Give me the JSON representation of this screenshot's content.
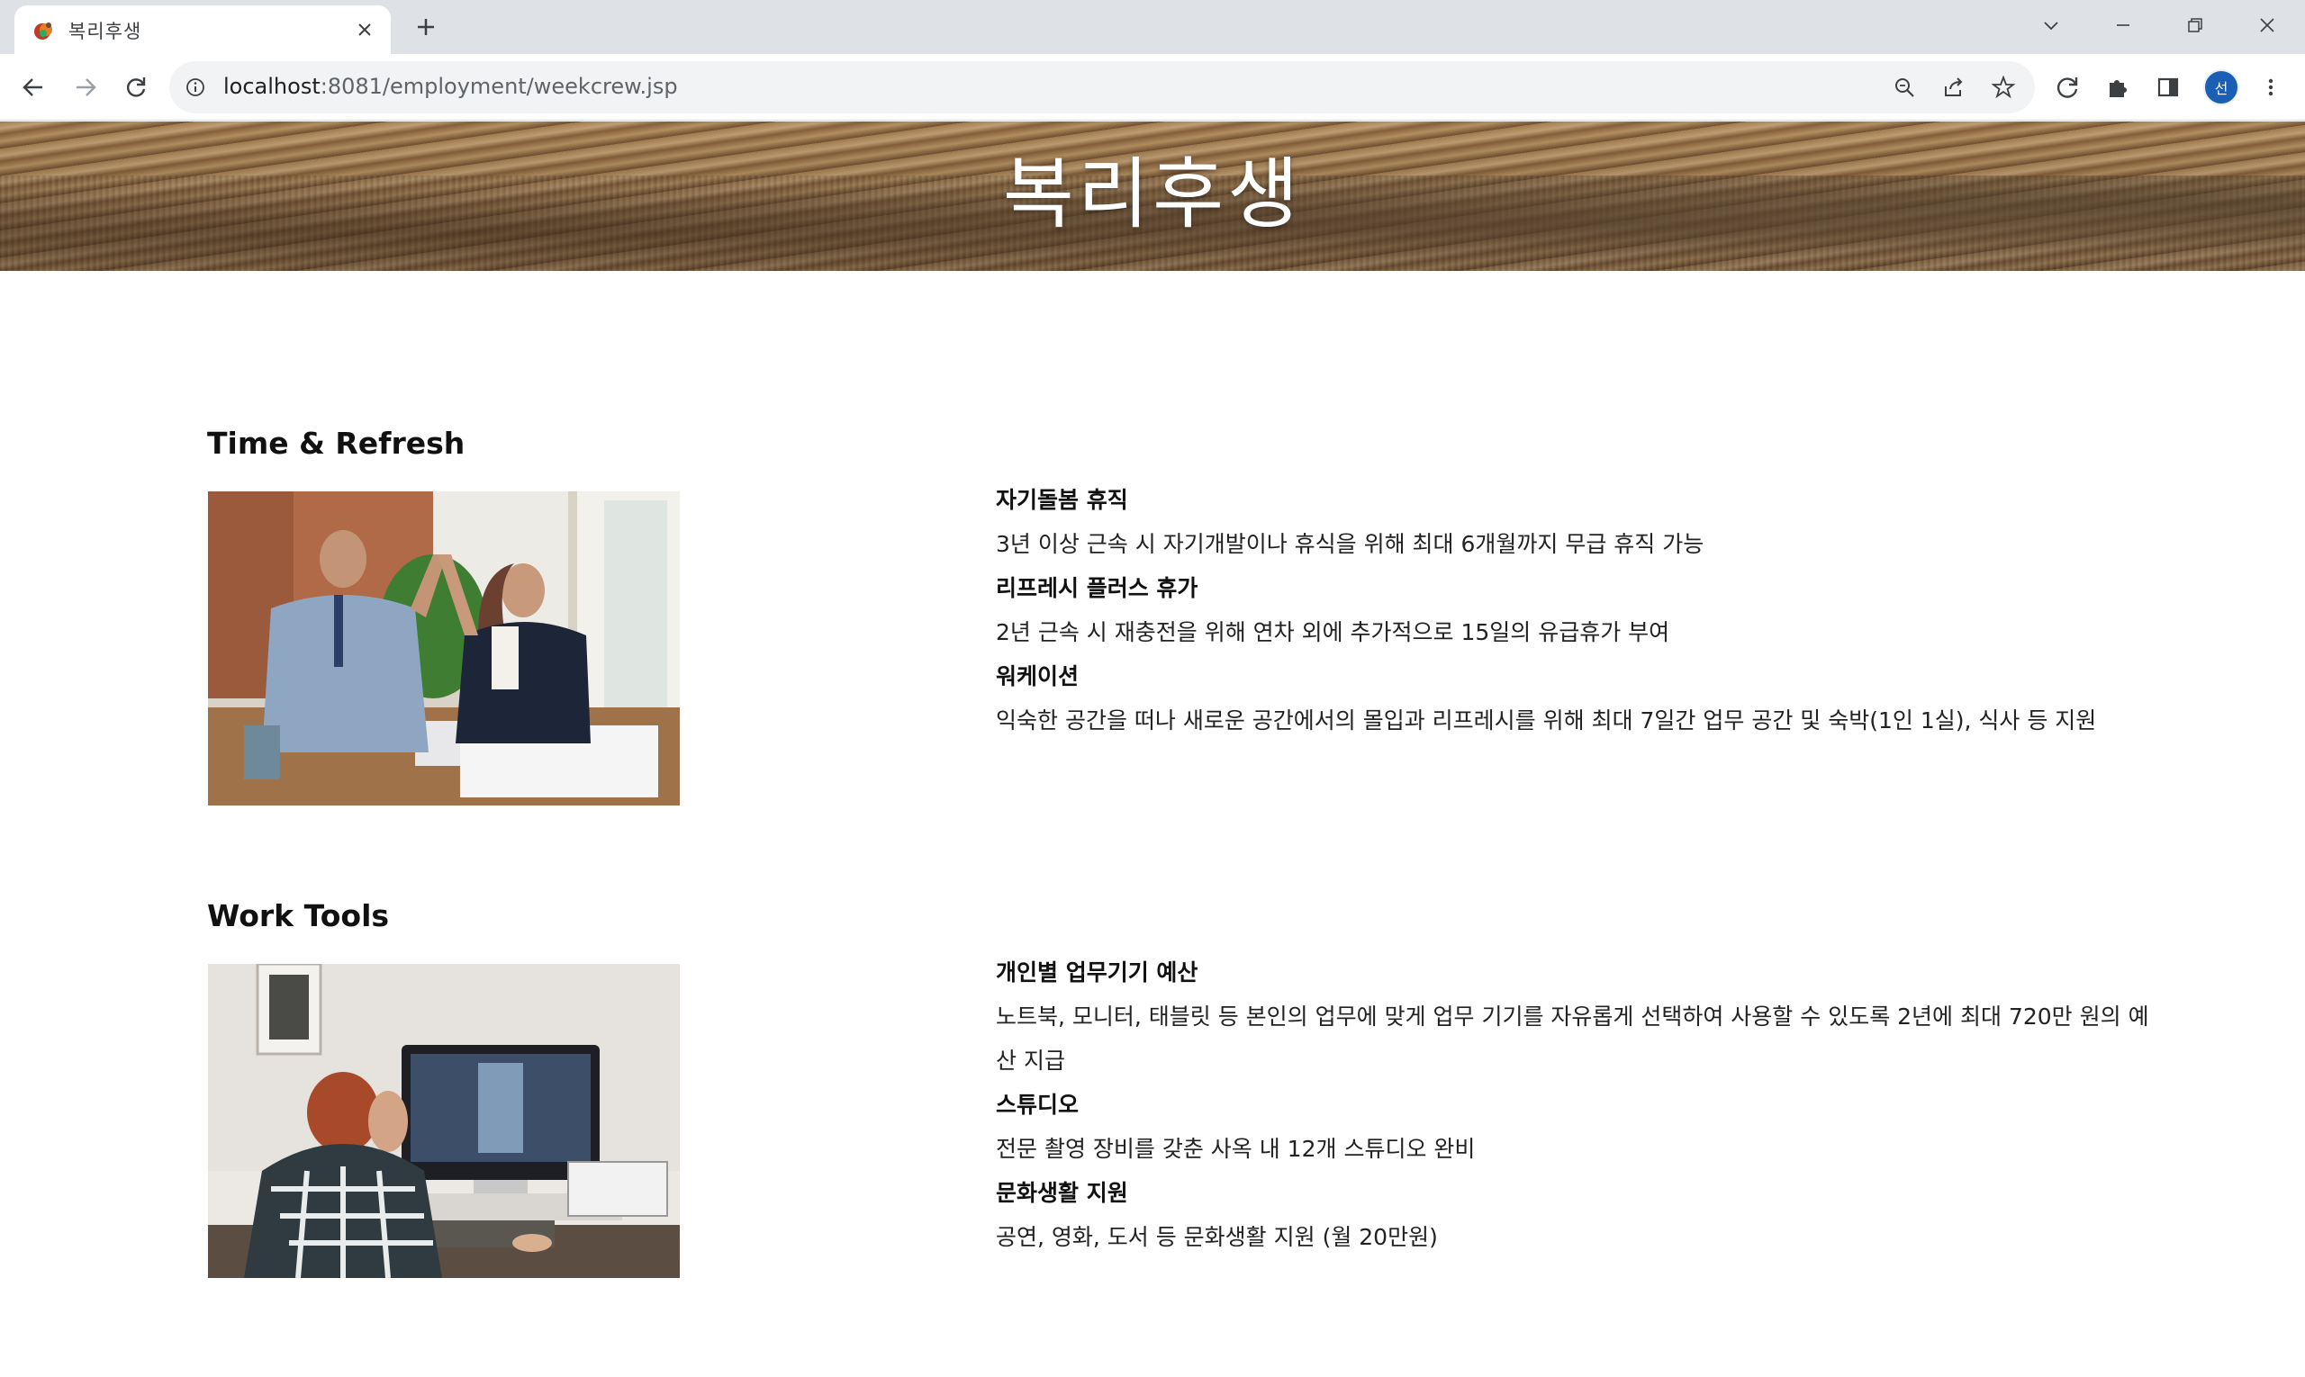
{
  "browser": {
    "tab_title": "복리후생",
    "url_host": "localhost",
    "url_path": ":8081/employment/weekcrew.jsp",
    "profile_initial": "선"
  },
  "page": {
    "hero_title": "복리후생",
    "sections": [
      {
        "title": "Time & Refresh",
        "benefits": [
          {
            "title": "자기돌봄 휴직",
            "desc": "3년 이상 근속 시 자기개발이나 휴식을 위해 최대 6개월까지 무급 휴직 가능"
          },
          {
            "title": "리프레시 플러스 휴가",
            "desc": "2년 근속 시 재충전을 위해 연차 외에 추가적으로 15일의 유급휴가 부여"
          },
          {
            "title": "워케이션",
            "desc": "익숙한 공간을 떠나 새로운 공간에서의 몰입과 리프레시를 위해 최대 7일간 업무 공간 및 숙박(1인 1실), 식사 등 지원"
          }
        ]
      },
      {
        "title": "Work Tools",
        "benefits": [
          {
            "title": "개인별 업무기기 예산",
            "desc": "노트북, 모니터, 태블릿 등 본인의 업무에 맞게 업무 기기를 자유롭게 선택하여 사용할 수 있도록 2년에 최대 720만 원의 예산 지급"
          },
          {
            "title": "스튜디오",
            "desc": "전문 촬영 장비를 갖춘 사옥 내 12개 스튜디오 완비"
          },
          {
            "title": "문화생활 지원",
            "desc": "공연, 영화, 도서 등 문화생활 지원 (월 20만원)"
          }
        ]
      }
    ]
  },
  "icons": {
    "favicon": "coffee-cup-icon",
    "back": "arrow-left-icon",
    "forward": "arrow-right-icon",
    "reload": "reload-icon",
    "info": "info-icon",
    "zoom": "zoom-icon",
    "share": "share-icon",
    "bookmark": "star-icon",
    "sync": "sync-icon",
    "extensions": "puzzle-icon",
    "side_panel": "side-panel-icon",
    "menu": "kebab-menu-icon"
  },
  "colors": {
    "chrome_bg": "#dee1e6",
    "omnibox_bg": "#f1f3f4",
    "avatar_bg": "#1a5fb4"
  }
}
